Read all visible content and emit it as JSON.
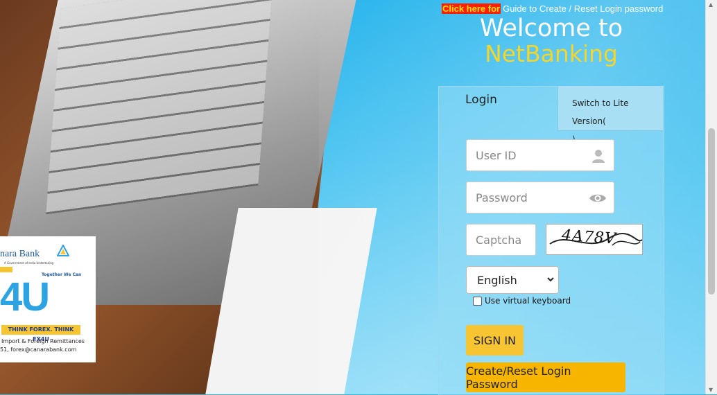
{
  "header": {
    "click_here": "Click here for",
    "guide_text": "Guide to Create / Reset Login password",
    "welcome": "Welcome to",
    "product": "NetBanking"
  },
  "tabs": {
    "login": "Login",
    "lite_line1": "Switch to Lite Version(",
    "lite_line2": ")"
  },
  "form": {
    "userid_placeholder": "User ID",
    "password_placeholder": "Password",
    "captcha_placeholder": "Captcha",
    "captcha_text": "4A78V",
    "language_selected": "English",
    "virtual_keyboard_label": "Use virtual keyboard",
    "signin_label": "SIGN IN",
    "create_reset_label": "Create/Reset Login Password"
  },
  "ad": {
    "bank_name": "nara Bank",
    "govt_line": "A Government of India Undertaking",
    "together": "Together We Can",
    "big_text": "4U",
    "slogan": "THINK FOREX. THINK FX4U",
    "line1": "Import & Foreign Remittances",
    "line2": "51, forex@canarabank.com"
  },
  "icons": {
    "user": "user-icon",
    "eye": "eye-icon",
    "chevron": "chevron-down-icon"
  },
  "colors": {
    "accent_yellow": "#f7c531",
    "netbanking_yellow": "#f4d52a",
    "click_bg": "#ff1e00"
  }
}
